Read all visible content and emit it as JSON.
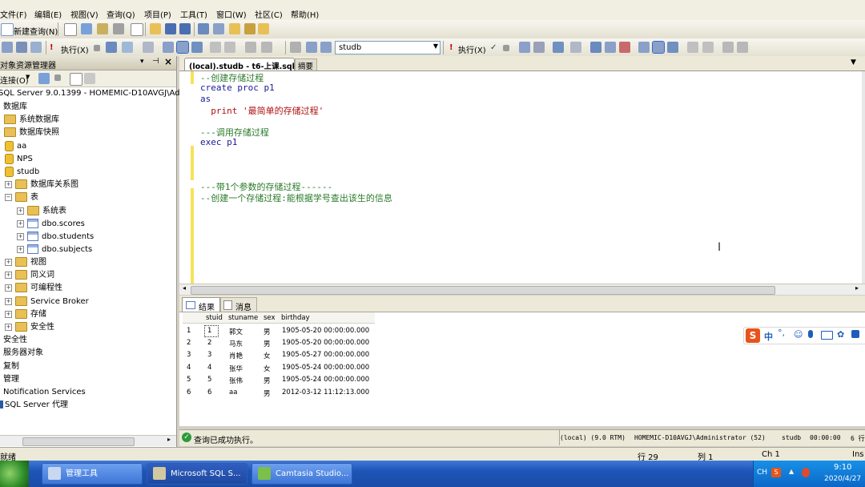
{
  "menu": [
    "文件(F)",
    "编辑(E)",
    "视图(V)",
    "查询(Q)",
    "项目(P)",
    "工具(T)",
    "窗口(W)",
    "社区(C)",
    "帮助(H)"
  ],
  "toolbar1": {
    "new_query": "新建查询(N)"
  },
  "toolbar2": {
    "execute": "执行(X)",
    "database": "studb",
    "execute2": "执行(X)"
  },
  "object_explorer": {
    "title": "对象资源管理器",
    "connect": "连接(O)",
    "tree": [
      {
        "label": "SQL Server 9.0.1399 - HOMEMIC-D10AVGJ\\Ad",
        "icon": "server-icon"
      },
      {
        "label": "数据库",
        "icon": "folder-icon"
      },
      {
        "label": "系统数据库",
        "icon": "folder-icon"
      },
      {
        "label": "数据库快照",
        "icon": "folder-icon"
      },
      {
        "label": "aa",
        "icon": "database-icon"
      },
      {
        "label": "NPS",
        "icon": "database-icon"
      },
      {
        "label": "studb",
        "icon": "database-icon"
      },
      {
        "label": "数据库关系图",
        "icon": "folder-icon"
      },
      {
        "label": "表",
        "icon": "folder-icon"
      },
      {
        "label": "系统表",
        "icon": "folder-icon"
      },
      {
        "label": "dbo.scores",
        "icon": "table-icon"
      },
      {
        "label": "dbo.students",
        "icon": "table-icon"
      },
      {
        "label": "dbo.subjects",
        "icon": "table-icon"
      },
      {
        "label": "视图",
        "icon": "folder-icon"
      },
      {
        "label": "同义词",
        "icon": "folder-icon"
      },
      {
        "label": "可编程性",
        "icon": "folder-icon"
      },
      {
        "label": "Service Broker",
        "icon": "folder-icon"
      },
      {
        "label": "存储",
        "icon": "folder-icon"
      },
      {
        "label": "安全性",
        "icon": "folder-icon"
      },
      {
        "label": "安全性",
        "icon": "none"
      },
      {
        "label": "服务器对象",
        "icon": "none"
      },
      {
        "label": "复制",
        "icon": "none"
      },
      {
        "label": "管理",
        "icon": "none"
      },
      {
        "label": "Notification Services",
        "icon": "none"
      },
      {
        "label": "SQL Server 代理",
        "icon": "agent-icon"
      }
    ]
  },
  "tabs": {
    "active": "(local).studb - t6-上课.sql*",
    "summary": "摘要"
  },
  "editor": {
    "lines": [
      "--创建存储过程",
      "create proc p1",
      "as",
      "  print '最简单的存储过程'",
      "",
      "---调用存储过程",
      "exec p1",
      "",
      "",
      "",
      "---带1个参数的存储过程------",
      "--创建一个存储过程:能根据学号查出该生的信息"
    ]
  },
  "results": {
    "tab_results": "结果",
    "tab_messages": "消息",
    "columns": [
      "stuid",
      "stuname",
      "sex",
      "birthday"
    ],
    "rows": [
      [
        "1",
        "1",
        "郭文",
        "男",
        "1905-05-20 00:00:00.000"
      ],
      [
        "2",
        "2",
        "马东",
        "男",
        "1905-05-20 00:00:00.000"
      ],
      [
        "3",
        "3",
        "肖艳",
        "女",
        "1905-05-27 00:00:00.000"
      ],
      [
        "4",
        "4",
        "张华",
        "女",
        "1905-05-24 00:00:00.000"
      ],
      [
        "5",
        "5",
        "张伟",
        "男",
        "1905-05-24 00:00:00.000"
      ],
      [
        "6",
        "6",
        "aa",
        "男",
        "2012-03-12 11:12:13.000"
      ]
    ]
  },
  "query_status": {
    "message": "查询已成功执行。",
    "server": "(local) (9.0 RTM)",
    "user": "HOMEMIC-D10AVGJ\\Administrator (52)",
    "db": "studb",
    "time": "00:00:00",
    "rows": "6 行"
  },
  "ime": {
    "label": "中"
  },
  "status_bar": {
    "ready": "就绪",
    "row": "行 29",
    "col": "列 1",
    "ch": "Ch 1",
    "ins": "Ins"
  },
  "taskbar": {
    "tasks": [
      "管理工具",
      "Microsoft SQL S...",
      "Camtasia Studio..."
    ],
    "lang": "CH",
    "time": "9:10",
    "date": "2020/4/27"
  }
}
